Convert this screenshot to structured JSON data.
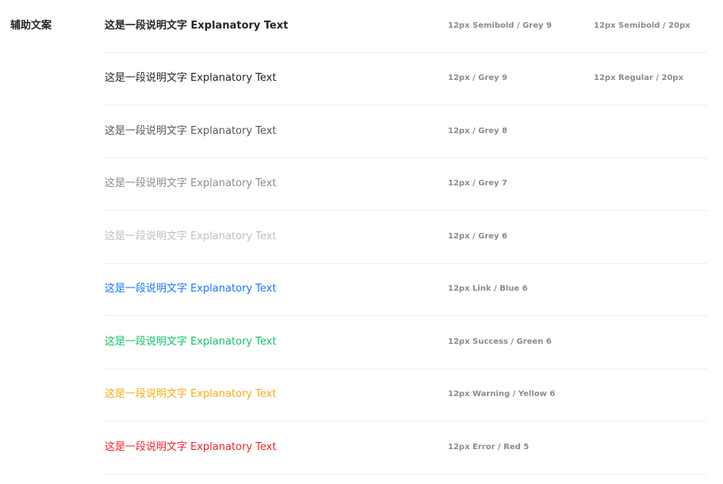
{
  "section": {
    "label": "辅助文案"
  },
  "rows": [
    {
      "text": "这是一段说明文字 Explanatory Text",
      "color": "#262626",
      "spec": "12px Semibold / Grey 9",
      "spec2": "12px Semibold / 20px",
      "weight": "semibold"
    },
    {
      "text": "这是一段说明文字 Explanatory Text",
      "color": "#262626",
      "spec": "12px / Grey 9",
      "spec2": "12px Regular / 20px",
      "weight": "regular"
    },
    {
      "text": "这是一段说明文字 Explanatory Text",
      "color": "#595959",
      "spec": "12px / Grey 8",
      "spec2": "",
      "weight": "regular"
    },
    {
      "text": "这是一段说明文字 Explanatory Text",
      "color": "#8c8c8c",
      "spec": "12px / Grey 7",
      "spec2": "",
      "weight": "regular"
    },
    {
      "text": "这是一段说明文字 Explanatory Text",
      "color": "#bfbfbf",
      "spec": "12px / Grey 6",
      "spec2": "",
      "weight": "regular"
    },
    {
      "text": "这是一段说明文字 Explanatory Text",
      "color": "#1677ff",
      "spec": "12px Link / Blue 6",
      "spec2": "",
      "weight": "regular"
    },
    {
      "text": "这是一段说明文字 Explanatory Text",
      "color": "#13c26b",
      "spec": "12px Success / Green 6",
      "spec2": "",
      "weight": "regular"
    },
    {
      "text": "这是一段说明文字 Explanatory Text",
      "color": "#faad14",
      "spec": "12px Warning / Yellow 6",
      "spec2": "",
      "weight": "regular"
    },
    {
      "text": "这是一段说明文字 Explanatory Text",
      "color": "#f5222d",
      "spec": "12px Error / Red 5",
      "spec2": "",
      "weight": "regular"
    }
  ]
}
